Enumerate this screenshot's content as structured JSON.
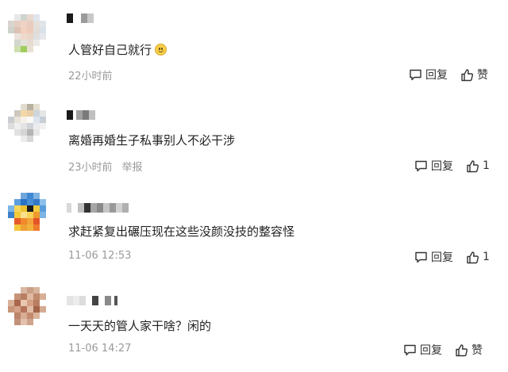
{
  "comments": [
    {
      "text": "人管好自己就行",
      "emoji": "smiley-face",
      "time": "22小时前",
      "report": "",
      "reply_label": "回复",
      "like_label": "赞"
    },
    {
      "text": "离婚再婚生子私事别人不必干涉",
      "time": "23小时前",
      "report": "举报",
      "reply_label": "回复",
      "like_label": "1"
    },
    {
      "text": "求赶紧复出碾压现在这些没颜没技的整容怪",
      "time": "11-06 12:53",
      "report": "",
      "reply_label": "回复",
      "like_label": "1"
    },
    {
      "text": "一天天的管人家干啥？闲的",
      "time": "11-06 14:27",
      "report": "",
      "reply_label": "回复",
      "like_label": "赞"
    }
  ],
  "icons": {
    "reply": "comment-bubble-icon",
    "like": "thumbs-up-icon"
  }
}
